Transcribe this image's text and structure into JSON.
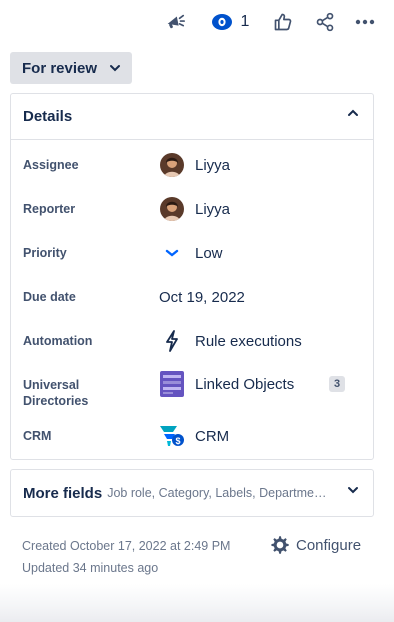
{
  "toolbar": {
    "feedback_icon": "megaphone-icon",
    "watch_icon": "eye-icon",
    "watch_count": "1",
    "like_icon": "thumbs-up-icon",
    "share_icon": "share-icon",
    "more_icon": "more-dots-icon"
  },
  "status": {
    "label": "For review",
    "icon": "chevron-down-icon"
  },
  "details": {
    "title": "Details",
    "collapse_icon": "chevron-up-icon",
    "fields": [
      {
        "label": "Assignee",
        "value": "Liyya",
        "icon": "avatar"
      },
      {
        "label": "Reporter",
        "value": "Liyya",
        "icon": "avatar"
      },
      {
        "label": "Priority",
        "value": "Low",
        "icon": "priority-low-icon"
      },
      {
        "label": "Due date",
        "value": "Oct 19, 2022"
      },
      {
        "label": "Automation",
        "value": "Rule executions",
        "icon": "lightning-icon"
      },
      {
        "label_line1": "Universal",
        "label_line2": "Directories",
        "value": "Linked Objects",
        "badge": "3",
        "icon": "linked-objects-icon"
      },
      {
        "label": "CRM",
        "value": "CRM",
        "icon": "crm-icon"
      }
    ]
  },
  "more_fields": {
    "title": "More fields",
    "summary": "Job role, Category, Labels, Departme…",
    "icon": "chevron-down-icon"
  },
  "meta": {
    "created": "Created October 17, 2022 at 2:49 PM",
    "updated": "Updated 34 minutes ago"
  },
  "configure": {
    "label": "Configure",
    "icon": "gear-icon"
  },
  "colors": {
    "accent": "#0052cc",
    "text": "#172b4d",
    "subtle": "#6b778c",
    "border": "#dfe1e6"
  }
}
